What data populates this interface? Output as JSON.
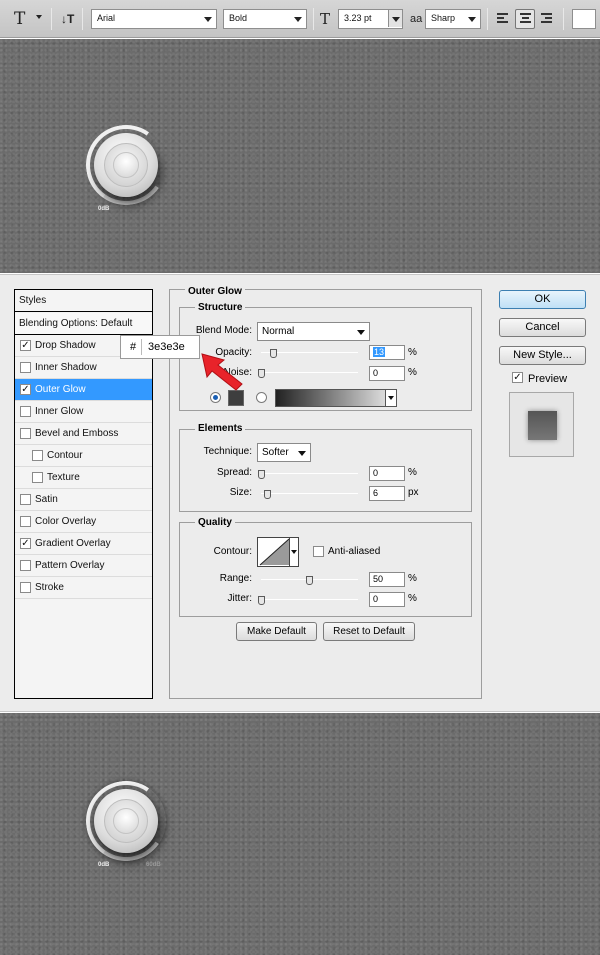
{
  "toolbar": {
    "text_tool_icon": "T",
    "orientation_icon": "↓T",
    "font_family": "Arial",
    "font_style": "Bold",
    "font_size_icon": "T",
    "font_size": "3.23 pt",
    "antialias_icon": "aa",
    "antialias": "Sharp",
    "align_buttons": [
      "align-left",
      "align-center",
      "align-right"
    ],
    "active_align": "align-center"
  },
  "canvas": {
    "background_color": "#6b6b6b",
    "knob_top": {
      "label_left": "0dB",
      "label_right": ""
    },
    "knob_bottom": {
      "label_left": "0dB",
      "label_right": "60dB"
    }
  },
  "styles_panel": {
    "header": "Styles",
    "blending": "Blending Options: Default",
    "items": [
      {
        "label": "Drop Shadow",
        "checked": true,
        "indent": false
      },
      {
        "label": "Inner Shadow",
        "checked": false,
        "indent": false
      },
      {
        "label": "Outer Glow",
        "checked": true,
        "indent": false,
        "selected": true
      },
      {
        "label": "Inner Glow",
        "checked": false,
        "indent": false
      },
      {
        "label": "Bevel and Emboss",
        "checked": false,
        "indent": false
      },
      {
        "label": "Contour",
        "checked": false,
        "indent": true
      },
      {
        "label": "Texture",
        "checked": false,
        "indent": true
      },
      {
        "label": "Satin",
        "checked": false,
        "indent": false
      },
      {
        "label": "Color Overlay",
        "checked": false,
        "indent": false
      },
      {
        "label": "Gradient Overlay",
        "checked": true,
        "indent": false
      },
      {
        "label": "Pattern Overlay",
        "checked": false,
        "indent": false
      },
      {
        "label": "Stroke",
        "checked": false,
        "indent": false
      }
    ]
  },
  "outer_glow": {
    "title": "Outer Glow",
    "structure": {
      "title": "Structure",
      "blend_mode_label": "Blend Mode:",
      "blend_mode": "Normal",
      "opacity_label": "Opacity:",
      "opacity": "13",
      "opacity_unit": "%",
      "noise_label": "Noise:",
      "noise": "0",
      "noise_unit": "%",
      "glow_color": "#3e3e3e"
    },
    "elements": {
      "title": "Elements",
      "technique_label": "Technique:",
      "technique": "Softer",
      "spread_label": "Spread:",
      "spread": "0",
      "spread_unit": "%",
      "size_label": "Size:",
      "size": "6",
      "size_unit": "px"
    },
    "quality": {
      "title": "Quality",
      "contour_label": "Contour:",
      "anti_aliased": "Anti-aliased",
      "range_label": "Range:",
      "range": "50",
      "range_unit": "%",
      "jitter_label": "Jitter:",
      "jitter": "0",
      "jitter_unit": "%"
    },
    "make_default": "Make Default",
    "reset_to_default": "Reset to Default"
  },
  "buttons": {
    "ok": "OK",
    "cancel": "Cancel",
    "new_style": "New Style...",
    "preview": "Preview"
  },
  "hex_popup": {
    "hash": "#",
    "value": "3e3e3e"
  },
  "colors": {
    "selection": "#3399ff",
    "annotation_arrow": "#e8232a"
  }
}
